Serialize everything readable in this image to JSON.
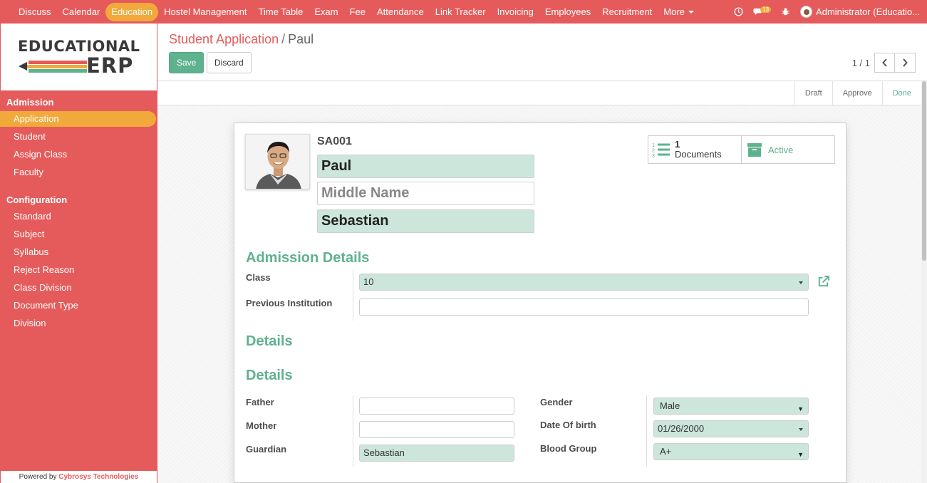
{
  "topbar": {
    "menu": [
      "Discuss",
      "Calendar",
      "Education",
      "Hostel Management",
      "Time Table",
      "Exam",
      "Fee",
      "Attendance",
      "Link Tracker",
      "Invoicing",
      "Employees",
      "Recruitment",
      "More"
    ],
    "active_index": 2,
    "notification_count": "13",
    "user": "Administrator (Educatio..."
  },
  "sidebar": {
    "logo_top": "EDUCATIONAL",
    "logo_bottom": "ERP",
    "sections": [
      {
        "title": "Admission",
        "items": [
          "Application",
          "Student",
          "Assign Class",
          "Faculty"
        ]
      },
      {
        "title": "Configuration",
        "items": [
          "Standard",
          "Subject",
          "Syllabus",
          "Reject Reason",
          "Class Division",
          "Document Type",
          "Division"
        ]
      }
    ],
    "active_item": "Application",
    "powered_prefix": "Powered by",
    "powered_by": "Cybrosys Technologies"
  },
  "control": {
    "breadcrumb_parent": "Student Application",
    "breadcrumb_sep": "/",
    "breadcrumb_current": "Paul",
    "save_label": "Save",
    "discard_label": "Discard",
    "pager": "1 / 1"
  },
  "statusbar": {
    "stages": [
      "Draft",
      "Approve",
      "Done"
    ],
    "current": "Done"
  },
  "form": {
    "ref": "SA001",
    "first_name": "Paul",
    "middle_name_placeholder": "Middle Name",
    "last_name": "Sebastian",
    "documents_count": "1",
    "documents_label": "Documents",
    "active_label": "Active",
    "admission_title": "Admission Details",
    "class_label": "Class",
    "class_value": "10",
    "prev_inst_label": "Previous Institution",
    "prev_inst_value": "",
    "details_title_1": "Details",
    "details_title_2": "Details",
    "father_label": "Father",
    "father_value": "",
    "mother_label": "Mother",
    "mother_value": "",
    "guardian_label": "Guardian",
    "guardian_value": "Sebastian",
    "gender_label": "Gender",
    "gender_value": "Male",
    "dob_label": "Date Of birth",
    "dob_value": "01/26/2000",
    "blood_label": "Blood Group",
    "blood_value": "A+"
  },
  "colors": {
    "brand": "#e55b5b",
    "accent": "#f2a93b",
    "success": "#5eb28e",
    "required_bg": "#cce6dc"
  }
}
